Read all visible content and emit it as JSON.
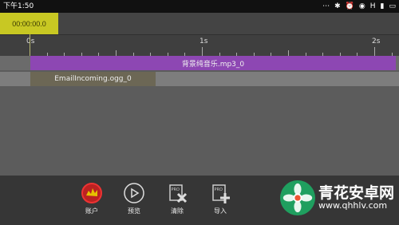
{
  "status_bar": {
    "time": "下午1:50",
    "icons": [
      "more-icon",
      "bluetooth-icon",
      "alarm-icon",
      "wifi-icon",
      "signal-icon",
      "battery-icon"
    ],
    "network": "H"
  },
  "toolbar": {
    "timecode": "00:00:00.0"
  },
  "ruler": {
    "labels": [
      "0s",
      "1s",
      "2s"
    ]
  },
  "tracks": {
    "music_clip": "背景纯音乐.mp3_0",
    "email_clip": "EmailIncoming.ogg_0"
  },
  "bottom": {
    "account": "账户",
    "preview": "预览",
    "clear": "清除",
    "import": "导入"
  },
  "watermark": {
    "main": "青花安卓网",
    "sub": "www.qhhlv.com"
  },
  "colors": {
    "accent_yellow": "#c8c823",
    "music_clip": "#8d47b3",
    "email_clip": "#6c6755",
    "watermark_green": "#1f9f5f"
  }
}
